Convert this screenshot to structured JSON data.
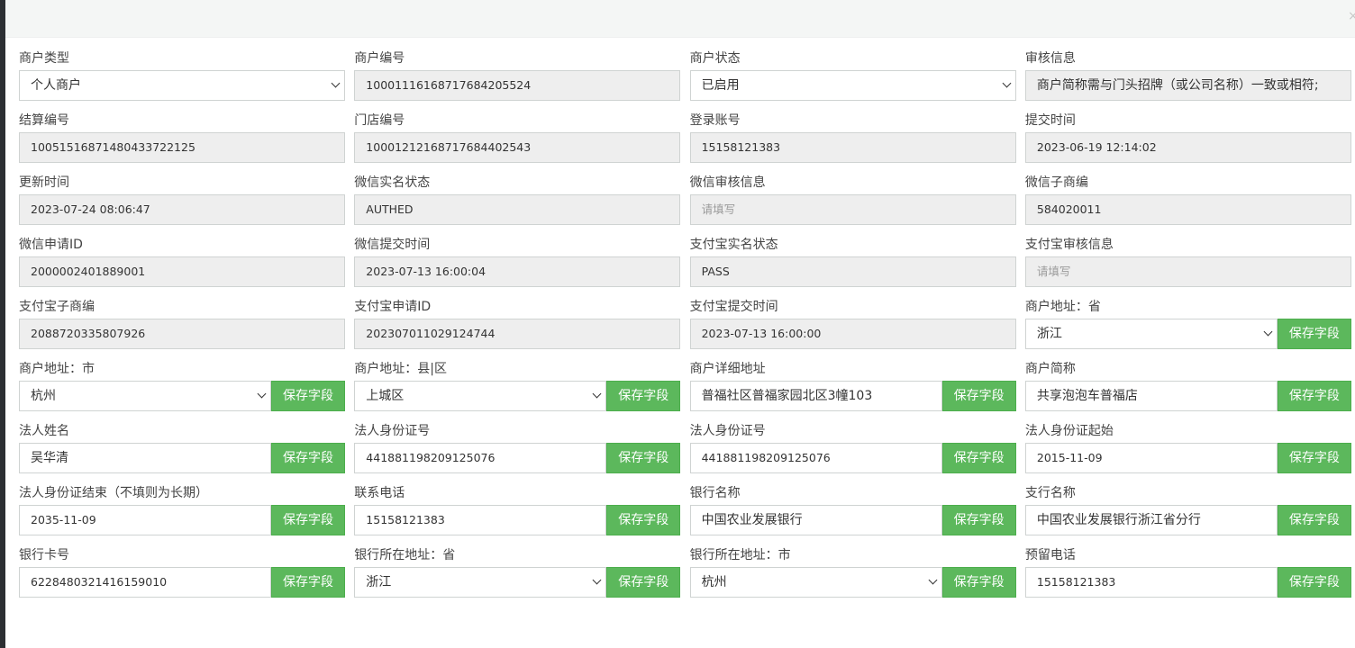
{
  "close_label": "×",
  "fields": [
    {
      "label": "商户类型",
      "value": "个人商户",
      "type": "select"
    },
    {
      "label": "商户编号",
      "value": "10001116168717684205524",
      "type": "readonly"
    },
    {
      "label": "商户状态",
      "value": "已启用",
      "type": "select"
    },
    {
      "label": "审核信息",
      "value": "商户简称需与门头招牌（或公司名称）一致或相符;",
      "type": "readonly"
    },
    {
      "label": "结算编号",
      "value": "10051516871480433722125",
      "type": "readonly"
    },
    {
      "label": "门店编号",
      "value": "10001212168717684402543",
      "type": "readonly"
    },
    {
      "label": "登录账号",
      "value": "15158121383",
      "type": "readonly"
    },
    {
      "label": "提交时间",
      "value": "2023-06-19 12:14:02",
      "type": "readonly"
    },
    {
      "label": "更新时间",
      "value": "2023-07-24 08:06:47",
      "type": "readonly"
    },
    {
      "label": "微信实名状态",
      "value": "AUTHED",
      "type": "readonly"
    },
    {
      "label": "微信审核信息",
      "value": "",
      "placeholder": "请填写",
      "type": "readonly"
    },
    {
      "label": "微信子商编",
      "value": "584020011",
      "type": "readonly"
    },
    {
      "label": "微信申请ID",
      "value": "2000002401889001",
      "type": "readonly"
    },
    {
      "label": "微信提交时间",
      "value": "2023-07-13 16:00:04",
      "type": "readonly"
    },
    {
      "label": "支付宝实名状态",
      "value": "PASS",
      "type": "readonly"
    },
    {
      "label": "支付宝审核信息",
      "value": "",
      "placeholder": "请填写",
      "type": "readonly"
    },
    {
      "label": "支付宝子商编",
      "value": "2088720335807926",
      "type": "readonly"
    },
    {
      "label": "支付宝申请ID",
      "value": "202307011029124744",
      "type": "readonly"
    },
    {
      "label": "支付宝提交时间",
      "value": "2023-07-13 16:00:00",
      "type": "readonly"
    },
    {
      "label": "商户地址：省",
      "value": "浙江",
      "type": "select-save"
    },
    {
      "label": "商户地址：市",
      "value": "杭州",
      "type": "select-save"
    },
    {
      "label": "商户地址：县|区",
      "value": "上城区",
      "type": "select-save"
    },
    {
      "label": "商户详细地址",
      "value": "普福社区普福家园北区3幢103",
      "type": "input-save"
    },
    {
      "label": "商户简称",
      "value": "共享泡泡车普福店",
      "type": "input-save"
    },
    {
      "label": "法人姓名",
      "value": "吴华清",
      "type": "input-save"
    },
    {
      "label": "法人身份证号",
      "value": "441881198209125076",
      "type": "input-save"
    },
    {
      "label": "法人身份证号",
      "value": "441881198209125076",
      "type": "input-save"
    },
    {
      "label": "法人身份证起始",
      "value": "2015-11-09",
      "type": "input-save"
    },
    {
      "label": "法人身份证结束（不填则为长期）",
      "value": "2035-11-09",
      "type": "input-save"
    },
    {
      "label": "联系电话",
      "value": "15158121383",
      "type": "input-save"
    },
    {
      "label": "银行名称",
      "value": "中国农业发展银行",
      "type": "input-save"
    },
    {
      "label": "支行名称",
      "value": "中国农业发展银行浙江省分行",
      "type": "input-save"
    },
    {
      "label": "银行卡号",
      "value": "6228480321416159010",
      "type": "input-save"
    },
    {
      "label": "银行所在地址：省",
      "value": "浙江",
      "type": "select-save"
    },
    {
      "label": "银行所在地址：市",
      "value": "杭州",
      "type": "select-save"
    },
    {
      "label": "预留电话",
      "value": "15158121383",
      "type": "input-save"
    }
  ],
  "save_button_label": "保存字段"
}
